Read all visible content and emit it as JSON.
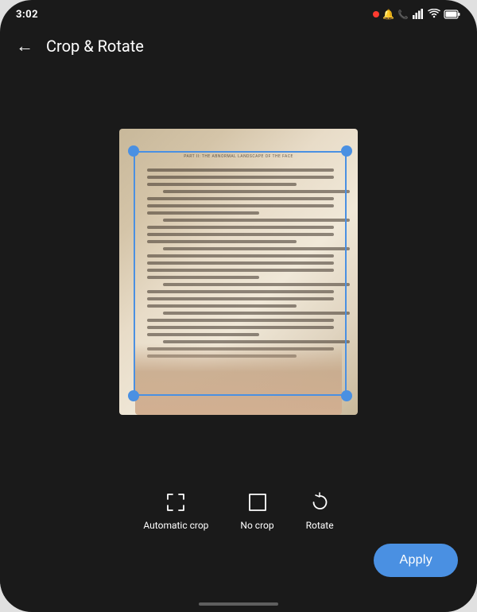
{
  "statusBar": {
    "time": "3:02",
    "icons": [
      "notification",
      "call",
      "battery-saver",
      "signal",
      "wifi",
      "battery"
    ]
  },
  "topBar": {
    "backLabel": "←",
    "title": "Crop & Rotate"
  },
  "tools": [
    {
      "id": "automatic-crop",
      "label": "Automatic crop",
      "icon": "auto-crop-icon"
    },
    {
      "id": "no-crop",
      "label": "No crop",
      "icon": "no-crop-icon"
    },
    {
      "id": "rotate",
      "label": "Rotate",
      "icon": "rotate-icon"
    }
  ],
  "applyButton": {
    "label": "Apply"
  },
  "pageHeader": "PART II: THE ABNORMAL LANDSCAPE OF THE FACE",
  "cropHandles": {
    "color": "#4a90e2"
  }
}
